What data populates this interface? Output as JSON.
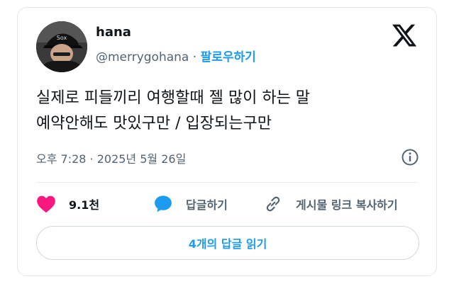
{
  "tweet": {
    "author": {
      "display_name": "hana",
      "handle": "@merrygohana",
      "separator": " · ",
      "follow_label": "팔로우하기"
    },
    "text_lines": [
      "실제로 피들끼리 여행할때 젤 많이 하는 말",
      "예약안해도 맛있구만 / 입장되는구만"
    ],
    "timestamp": "오후 7:28 · 2025년 5월 26일"
  },
  "actions": {
    "like_count": "9.1천",
    "reply_label": "답글하기",
    "copy_link_label": "게시물 링크 복사하기"
  },
  "replies_button": {
    "label": "4개의 답글 읽기"
  },
  "colors": {
    "accent": "#1d9bf0",
    "like": "#f91880",
    "text_secondary": "#536471"
  },
  "icons": [
    "x-logo-icon",
    "info-icon",
    "heart-icon",
    "speech-bubble-icon",
    "link-icon"
  ]
}
